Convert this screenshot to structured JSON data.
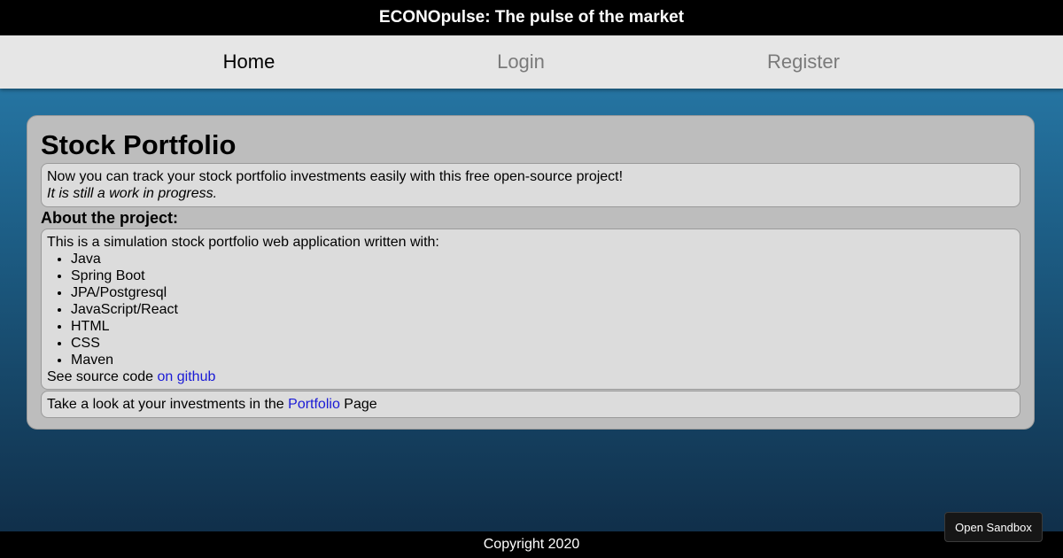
{
  "header": {
    "title": "ECONOpulse: The pulse of the market"
  },
  "nav": {
    "home": "Home",
    "login": "Login",
    "register": "Register"
  },
  "main": {
    "title": "Stock Portfolio",
    "intro_line": "Now you can track your stock portfolio investments easily with this free open-source project!",
    "intro_note": "It is still a work in progress.",
    "about_heading": "About the project:",
    "about_intro": "This is a simulation stock portfolio web application written with:",
    "tech_list": [
      "Java",
      "Spring Boot",
      "JPA/Postgresql",
      "JavaScript/React",
      "HTML",
      "CSS",
      "Maven"
    ],
    "source_text": "See source code ",
    "source_link": "on github",
    "cta_prefix": "Take a look at your investments in the ",
    "cta_link": "Portfolio",
    "cta_suffix": " Page"
  },
  "sandbox_button": "Open Sandbox",
  "footer": {
    "copyright": "Copyright 2020"
  },
  "colors": {
    "link": "#1a1ad6",
    "nav_active": "#000000",
    "nav_inactive": "#7a7a7a"
  }
}
